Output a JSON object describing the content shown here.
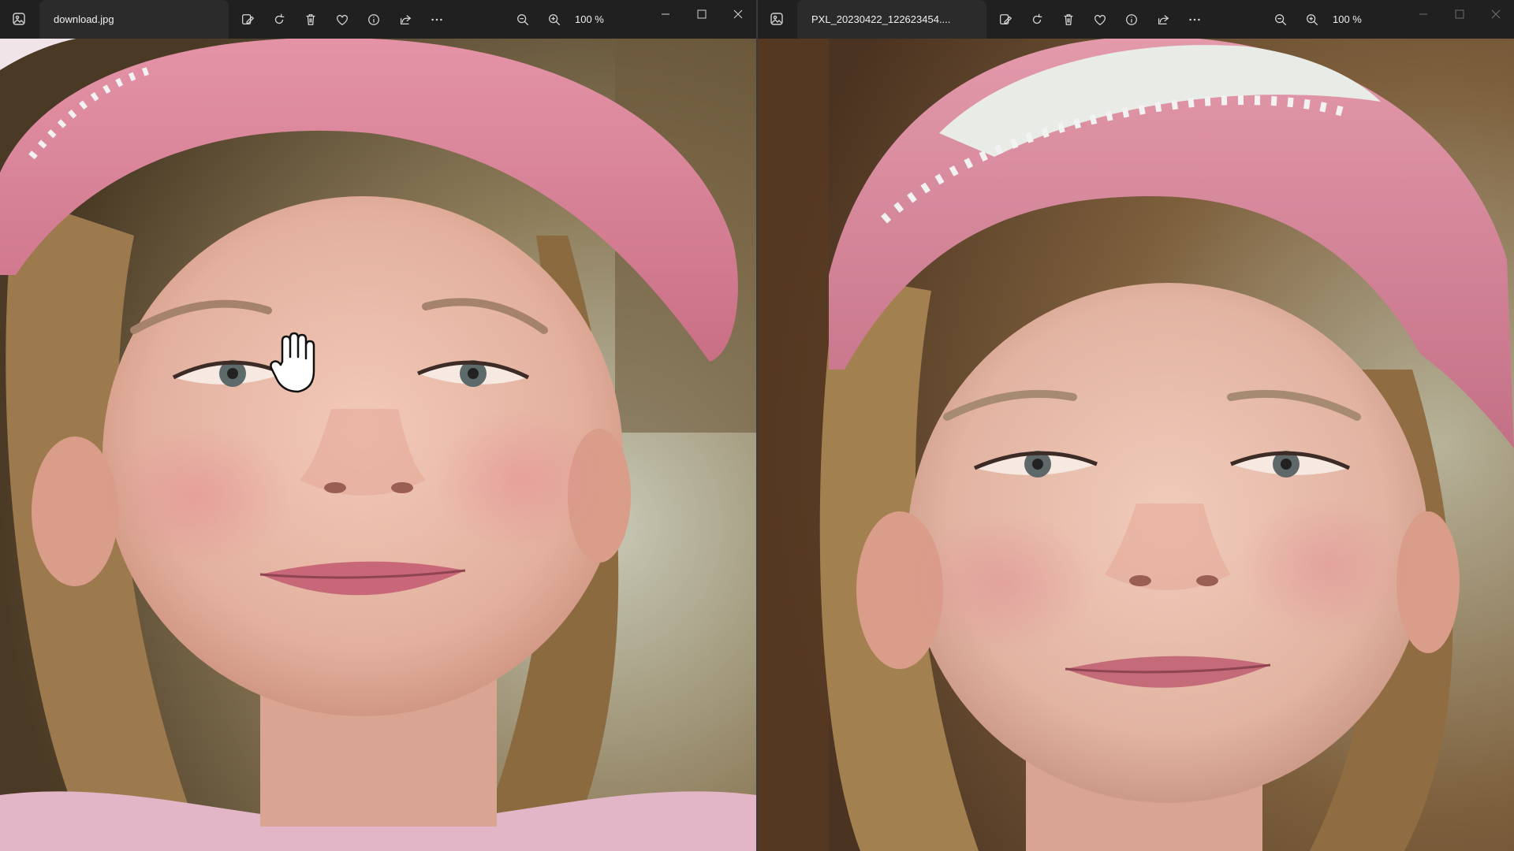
{
  "left_window": {
    "tab_title": "download.jpg",
    "zoom_level": "100 %"
  },
  "right_window": {
    "tab_title": "PXL_20230422_122623454....",
    "zoom_level": "100 %"
  },
  "toolbar_icons": [
    "edit-image-icon",
    "rotate-icon",
    "delete-icon",
    "favorite-icon",
    "info-icon",
    "share-icon",
    "more-icon",
    "zoom-out-icon",
    "zoom-in-icon"
  ],
  "colors": {
    "titlebar": "#202020",
    "cap_pink": "#d8798f",
    "skin": "#e7b8a6"
  }
}
